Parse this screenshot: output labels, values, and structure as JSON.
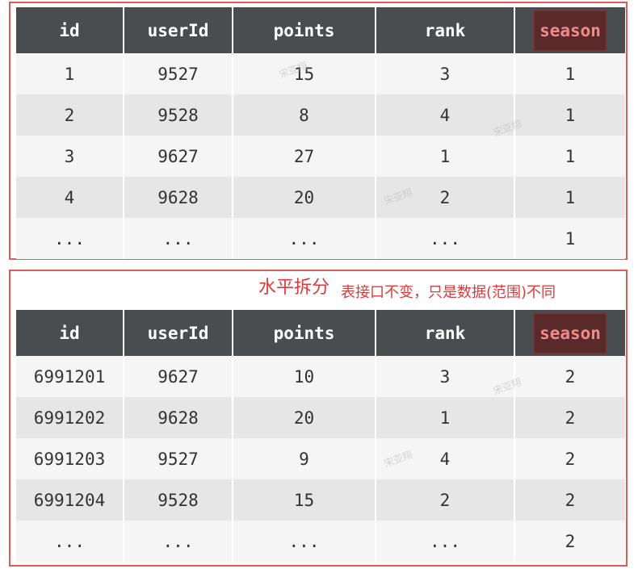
{
  "top_table": {
    "columns": [
      "id",
      "userId",
      "points",
      "rank",
      "season"
    ],
    "rows": [
      [
        "1",
        "9527",
        "15",
        "3",
        "1"
      ],
      [
        "2",
        "9528",
        "8",
        "4",
        "1"
      ],
      [
        "3",
        "9627",
        "27",
        "1",
        "1"
      ],
      [
        "4",
        "9628",
        "20",
        "2",
        "1"
      ],
      [
        "...",
        "...",
        "...",
        "...",
        "1"
      ]
    ]
  },
  "annotation": {
    "title": "水平拆分",
    "description": "表接口不变，只是数据(范围)不同"
  },
  "bottom_table": {
    "columns": [
      "id",
      "userId",
      "points",
      "rank",
      "season"
    ],
    "rows": [
      [
        "6991201",
        "9627",
        "10",
        "3",
        "2"
      ],
      [
        "6991202",
        "9628",
        "20",
        "1",
        "2"
      ],
      [
        "6991203",
        "9527",
        "9",
        "4",
        "2"
      ],
      [
        "6991204",
        "9528",
        "15",
        "2",
        "2"
      ],
      [
        "...",
        "...",
        "...",
        "...",
        "2"
      ]
    ]
  },
  "watermark": "宋亚翔",
  "colors": {
    "frame_border": "#e05a5a",
    "header_bg": "#4a4d4f",
    "highlight_text": "#f08a8a",
    "annotation_text": "#d93a3a"
  }
}
